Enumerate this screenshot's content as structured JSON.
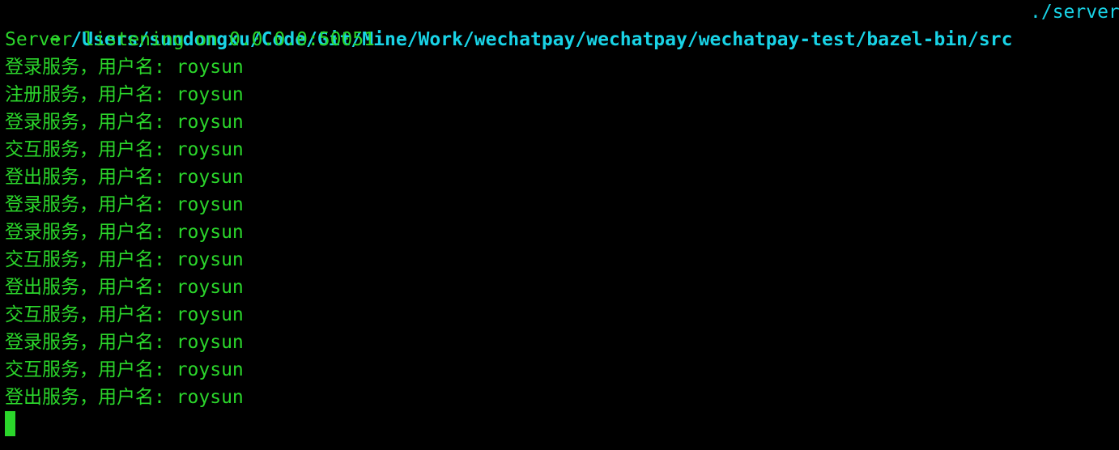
{
  "prompt": {
    "arrow": "➜",
    "path": "/Users/sundongxu/Code/Git/Mine/Work/wechatpay/wechatpay/wechatpay-test/bazel-bin/src",
    "command": "./server"
  },
  "output": [
    "Server listening on 0.0.0.0:50051",
    "登录服务，用户名: roysun",
    "注册服务，用户名: roysun",
    "登录服务，用户名: roysun",
    "交互服务，用户名: roysun",
    "登出服务，用户名: roysun",
    "登录服务，用户名: roysun",
    "登录服务，用户名: roysun",
    "交互服务，用户名: roysun",
    "登出服务，用户名: roysun",
    "交互服务，用户名: roysun",
    "登录服务，用户名: roysun",
    "交互服务，用户名: roysun",
    "登出服务，用户名: roysun"
  ],
  "colors": {
    "background": "#000000",
    "output_text": "#2bd62b",
    "prompt_path": "#19d3e6",
    "cursor": "#2bd62b"
  }
}
